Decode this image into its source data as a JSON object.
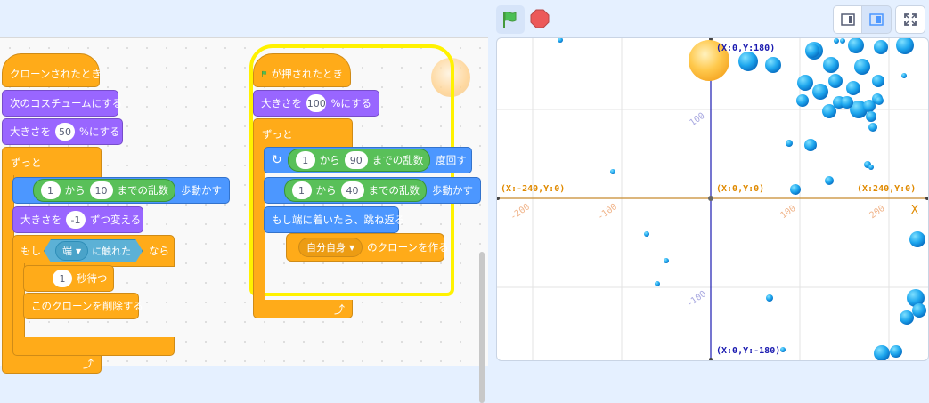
{
  "toolbar": {
    "green_flag_icon": "green-flag-icon",
    "stop_icon": "stop-icon",
    "small_stage_icon": "small-stage-icon",
    "large_stage_icon": "large-stage-icon",
    "fullscreen_icon": "fullscreen-icon"
  },
  "script1": {
    "hat": "クローンされたとき",
    "next_costume": "次のコスチュームにする",
    "set_size_label": "大きさを",
    "set_size_value": "50",
    "set_size_suffix": "%にする",
    "forever": "ずっと",
    "move_from": "1",
    "move_from_text": "から",
    "move_to": "10",
    "move_random_text": "までの乱数",
    "move_suffix": "歩動かす",
    "change_size_label": "大きさを",
    "change_size_value": "-1",
    "change_size_suffix": "ずつ変える",
    "if_label": "もし",
    "touching_option": "端",
    "touching_suffix": "に触れた",
    "then_label": "なら",
    "wait_value": "1",
    "wait_suffix": "秒待つ",
    "delete_clone": "このクローンを削除する"
  },
  "script2": {
    "hat": "が押されたとき",
    "set_size_label": "大きさを",
    "set_size_value": "100",
    "set_size_suffix": "%にする",
    "forever": "ずっと",
    "turn_from": "1",
    "turn_from_text": "から",
    "turn_to": "90",
    "turn_random_text": "までの乱数",
    "turn_suffix": "度回す",
    "move_from": "1",
    "move_from_text": "から",
    "move_to": "40",
    "move_random_text": "までの乱数",
    "move_suffix": "歩動かす",
    "bounce": "もし端に着いたら、跳ね返る",
    "clone_option": "自分自身",
    "clone_suffix": "のクローンを作る"
  },
  "stage": {
    "top": "(X:0,Y:180)",
    "bottom": "(X:0,Y:-180)",
    "left": "(X:-240,Y:0)",
    "right": "(X:240,Y:0)",
    "center": "(X:0,Y:0)",
    "x_axis_letter": "X",
    "tick_x": [
      "-200",
      "-100",
      "100",
      "200"
    ],
    "tick_y": [
      "100",
      "-100"
    ]
  },
  "colors": {
    "looks": "#9966ff",
    "control": "#ffab19",
    "motion": "#4c97ff",
    "operator": "#59c059",
    "sensing": "#5cb1d6",
    "event": "#ffbf00"
  }
}
